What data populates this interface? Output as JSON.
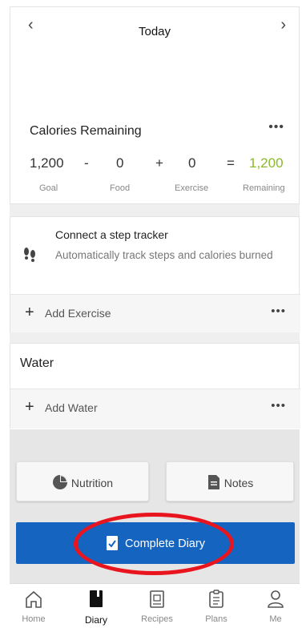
{
  "header": {
    "date_label": "Today",
    "prev_icon": "chevron-left-icon",
    "next_icon": "chevron-right-icon"
  },
  "calories": {
    "title": "Calories Remaining",
    "more_label": "•••",
    "goal_value": "1,200",
    "minus": "-",
    "food_value": "0",
    "plus": "+",
    "exercise_value": "0",
    "equals": "=",
    "remaining_value": "1,200",
    "goal_label": "Goal",
    "food_label": "Food",
    "exercise_label": "Exercise",
    "remaining_label": "Remaining",
    "remaining_color": "#8bb82c"
  },
  "step_tracker": {
    "title": "Connect a step tracker",
    "subtitle": "Automatically track steps and calories burned",
    "icon": "footsteps-icon"
  },
  "exercise": {
    "add_label": "Add Exercise",
    "more_label": "•••"
  },
  "water": {
    "title": "Water",
    "add_label": "Add Water",
    "more_label": "•••"
  },
  "actions": {
    "nutrition_label": "Nutrition",
    "notes_label": "Notes",
    "complete_label": "Complete Diary",
    "complete_color": "#1565c0",
    "highlight_color": "#e8141e"
  },
  "nav": {
    "items": [
      {
        "label": "Home",
        "icon": "home-icon"
      },
      {
        "label": "Diary",
        "icon": "diary-icon"
      },
      {
        "label": "Recipes",
        "icon": "recipes-icon"
      },
      {
        "label": "Plans",
        "icon": "plans-icon"
      },
      {
        "label": "Me",
        "icon": "person-icon"
      }
    ],
    "active": "Diary"
  }
}
